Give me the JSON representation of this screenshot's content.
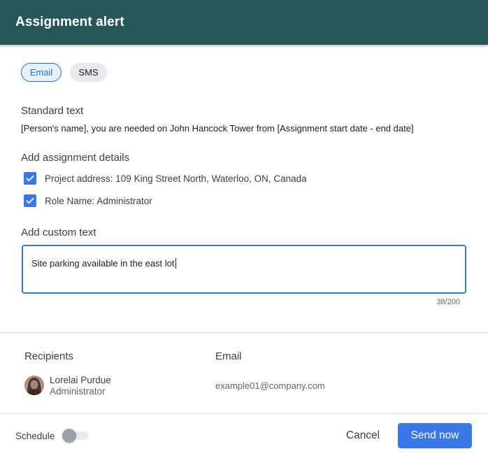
{
  "header": {
    "title": "Assignment alert"
  },
  "channels": {
    "email_label": "Email",
    "sms_label": "SMS",
    "selected": "Email"
  },
  "standard": {
    "label": "Standard text",
    "text": "[Person's name], you are needed on John Hancock Tower from [Assignment start date - end date]"
  },
  "details": {
    "label": "Add assignment details",
    "items": [
      {
        "label": "Project address: 109 King Street North, Waterloo, ON, Canada",
        "checked": true
      },
      {
        "label": "Role Name: Administrator",
        "checked": true
      }
    ]
  },
  "custom": {
    "label": "Add custom text",
    "value": "Site parking available in the east lot",
    "counter": "38/200"
  },
  "recipients": {
    "header_recipients": "Recipients",
    "header_email": "Email",
    "rows": [
      {
        "name": "Lorelai Purdue",
        "role": "Administrator",
        "email": "example01@company.com"
      }
    ]
  },
  "footer": {
    "schedule_label": "Schedule",
    "schedule_on": false,
    "cancel_label": "Cancel",
    "send_label": "Send now"
  },
  "colors": {
    "header_bg": "#265657",
    "accent": "#3b78e7",
    "chip_email_bg": "#e8f0fe"
  },
  "icons": {
    "checkbox": "check-icon",
    "avatar": "avatar-photo"
  }
}
